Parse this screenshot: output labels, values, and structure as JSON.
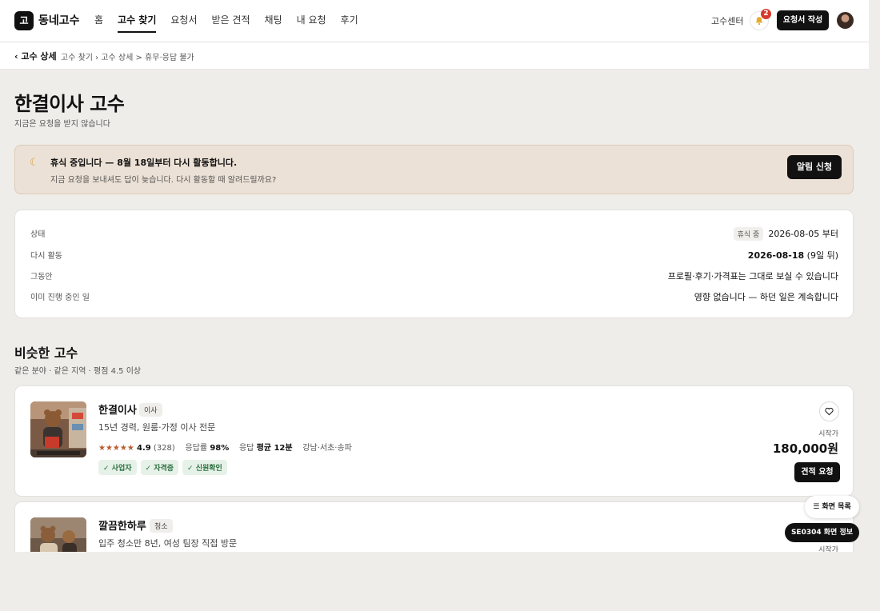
{
  "header": {
    "logo_mark": "고",
    "logo_text": "동네고수",
    "nav": [
      {
        "label": "홈",
        "active": false
      },
      {
        "label": "고수 찾기",
        "active": true
      },
      {
        "label": "요청서",
        "active": false
      },
      {
        "label": "받은 견적",
        "active": false
      },
      {
        "label": "채팅",
        "active": false
      },
      {
        "label": "내 요청",
        "active": false
      },
      {
        "label": "후기",
        "active": false
      }
    ],
    "center_link": "고수센터",
    "notification_count": "2",
    "write_button": "요청서 작성"
  },
  "breadcrumb": {
    "back": "‹ 고수 상세",
    "path": "고수 찾기  ›  고수 상세 > 휴무·응답 불가"
  },
  "page": {
    "title": "한결이사 고수",
    "subtitle": "지금은 요청을 받지 않습니다"
  },
  "notice": {
    "title": "휴식 중입니다 — 8월 18일부터 다시 활동합니다.",
    "message": "지금 요청을 보내셔도 답이 늦습니다. 다시 활동할 때 알려드릴까요?",
    "button": "알림 신청"
  },
  "status": {
    "rows": [
      {
        "label": "상태",
        "pill": "휴식 중",
        "value": "2026-08-05 부터"
      },
      {
        "label": "다시 활동",
        "value_bold": "2026-08-18",
        "value": " (9일 뒤)"
      },
      {
        "label": "그동안",
        "value": "프로필·후기·가격표는 그대로 보실 수 있습니다"
      },
      {
        "label": "이미 진행 중인 일",
        "value": "영향 없습니다 — 하던 일은 계속합니다"
      }
    ]
  },
  "similar": {
    "title": "비슷한 고수",
    "subtitle": "같은 분야 · 같은 지역 · 평점 4.5 이상",
    "pros": [
      {
        "name": "한결이사",
        "tag": "이사",
        "desc": "15년 경력, 원룸·가정 이사 전문",
        "stars": "★★★★★",
        "rating": "4.9",
        "reviews": "(328)",
        "response_label": "응답률",
        "response_rate": "98%",
        "response_time_label": "응답",
        "response_time": "평균 12분",
        "area": "강남·서초·송파",
        "badges": [
          "✓ 사업자",
          "✓ 자격증",
          "✓ 신원확인"
        ],
        "price_label": "시작가",
        "price": "180,000원",
        "button": "견적 요청"
      },
      {
        "name": "깔끔한하루",
        "tag": "청소",
        "desc": "입주 청소만 8년, 여성 팀장 직접 방문",
        "price_label": "시작가"
      }
    ]
  },
  "floating": {
    "screen_list": "☰ 화면 목록",
    "screen_info": "SE0304 화면 정보"
  },
  "colors": {
    "background": "#efedea",
    "notice_bg": "#ece1d6",
    "star": "#b85c30",
    "badge_green": "#2c6e3f",
    "notification": "#d63a2f"
  }
}
